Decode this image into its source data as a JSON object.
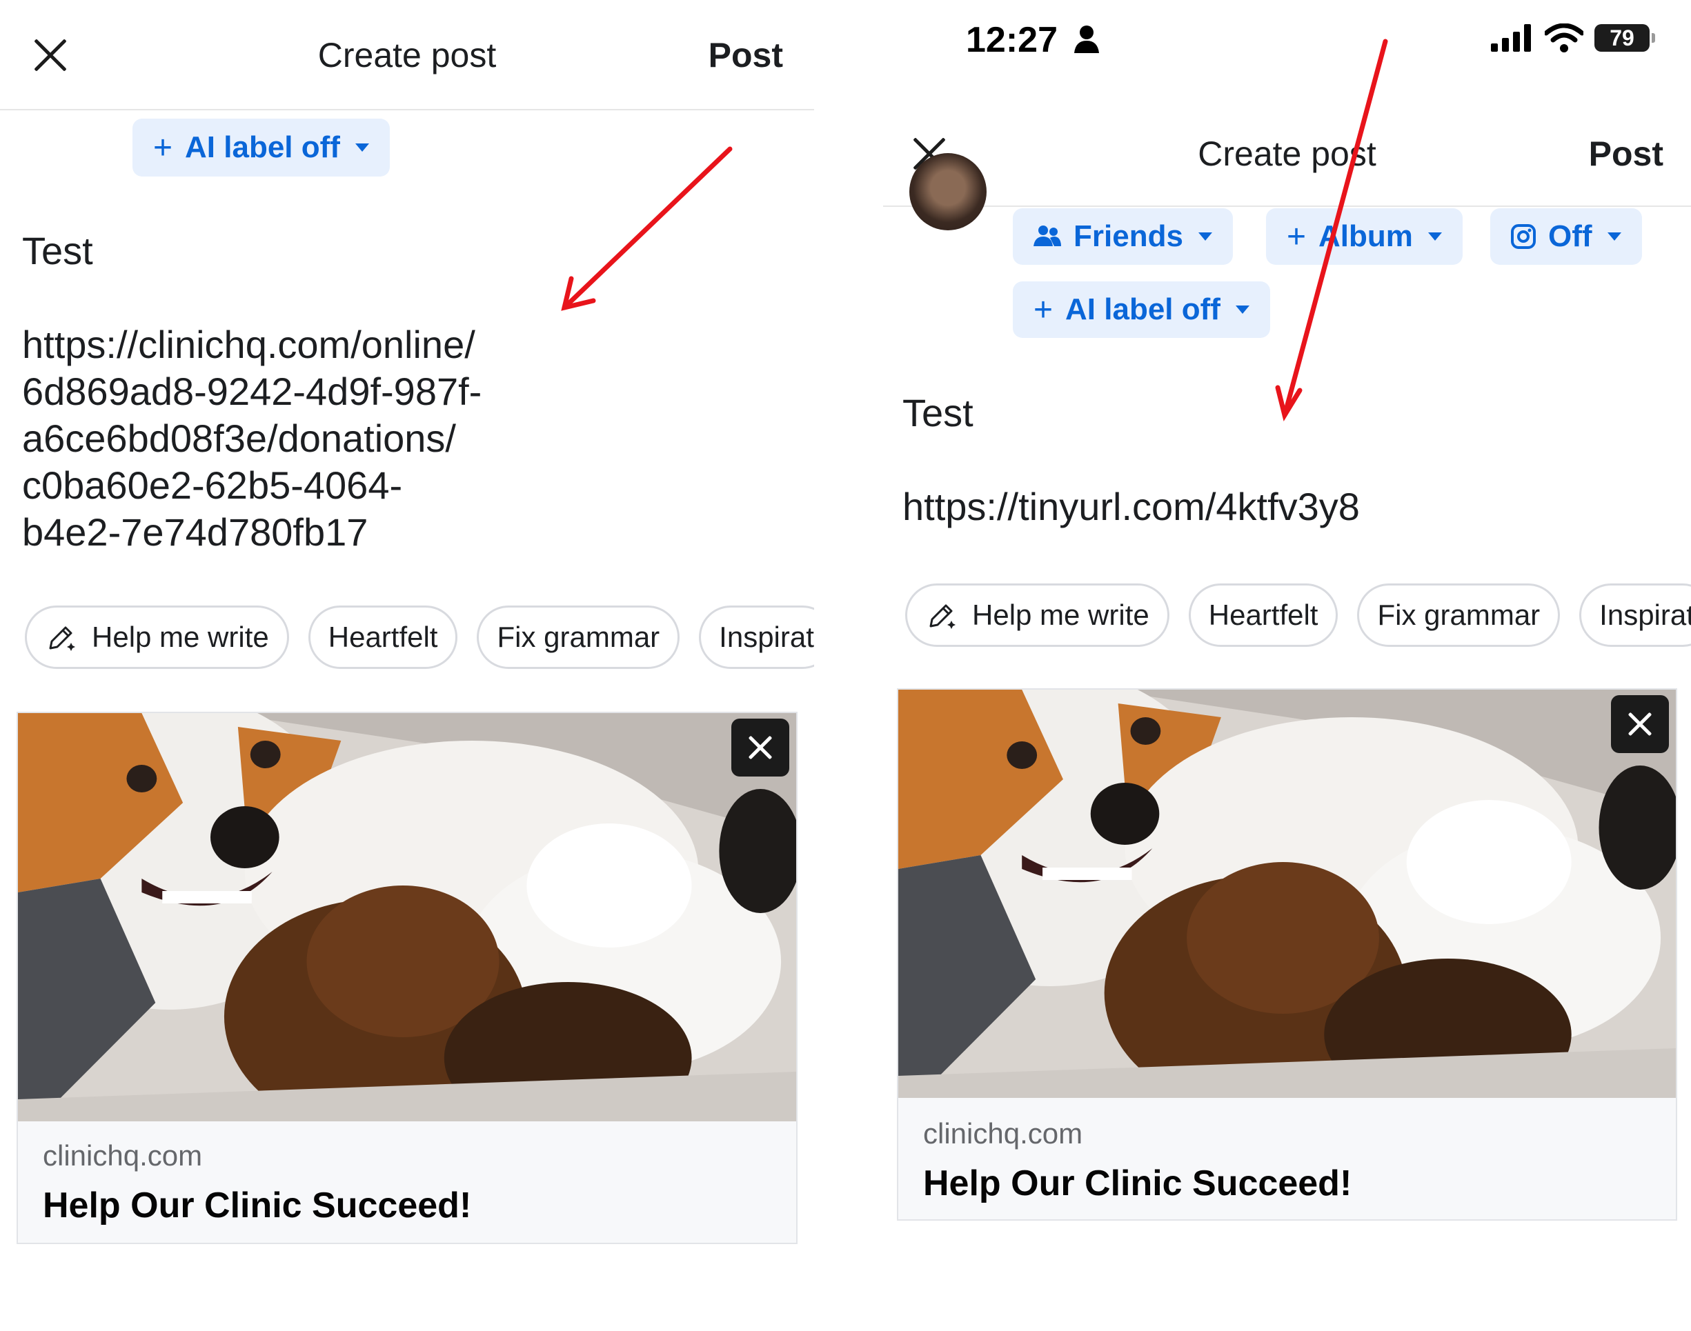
{
  "left": {
    "header": {
      "title": "Create post",
      "post_label": "Post"
    },
    "ai_label_pill": {
      "label": "AI label off"
    },
    "post_lines": [
      "Test",
      "https://clinichq.com/online/",
      "6d869ad8-9242-4d9f-987f-",
      "a6ce6bd08f3e/donations/",
      "c0ba60e2-62b5-4064-",
      "b4e2-7e74d780fb17"
    ],
    "chips": [
      "Help me write",
      "Heartfelt",
      "Fix grammar",
      "Inspirat"
    ],
    "preview": {
      "domain": "clinichq.com",
      "title": "Help Our Clinic Succeed!"
    }
  },
  "right": {
    "status_bar": {
      "time": "12:27",
      "battery": "79"
    },
    "header": {
      "title": "Create post",
      "post_label": "Post"
    },
    "audience_pills": {
      "friends": "Friends",
      "album": "Album",
      "instagram": "Off",
      "ai_label": "AI label off"
    },
    "post_lines": [
      "Test",
      "https://tinyurl.com/4ktfv3y8"
    ],
    "chips": [
      "Help me write",
      "Heartfelt",
      "Fix grammar",
      "Inspirat"
    ],
    "preview": {
      "domain": "clinichq.com",
      "title": "Help Our Clinic Succeed!"
    }
  },
  "colors": {
    "accent_blue": "#0a66d8",
    "pill_bg": "#e7f0fd",
    "annotation_red": "#e8141b"
  }
}
